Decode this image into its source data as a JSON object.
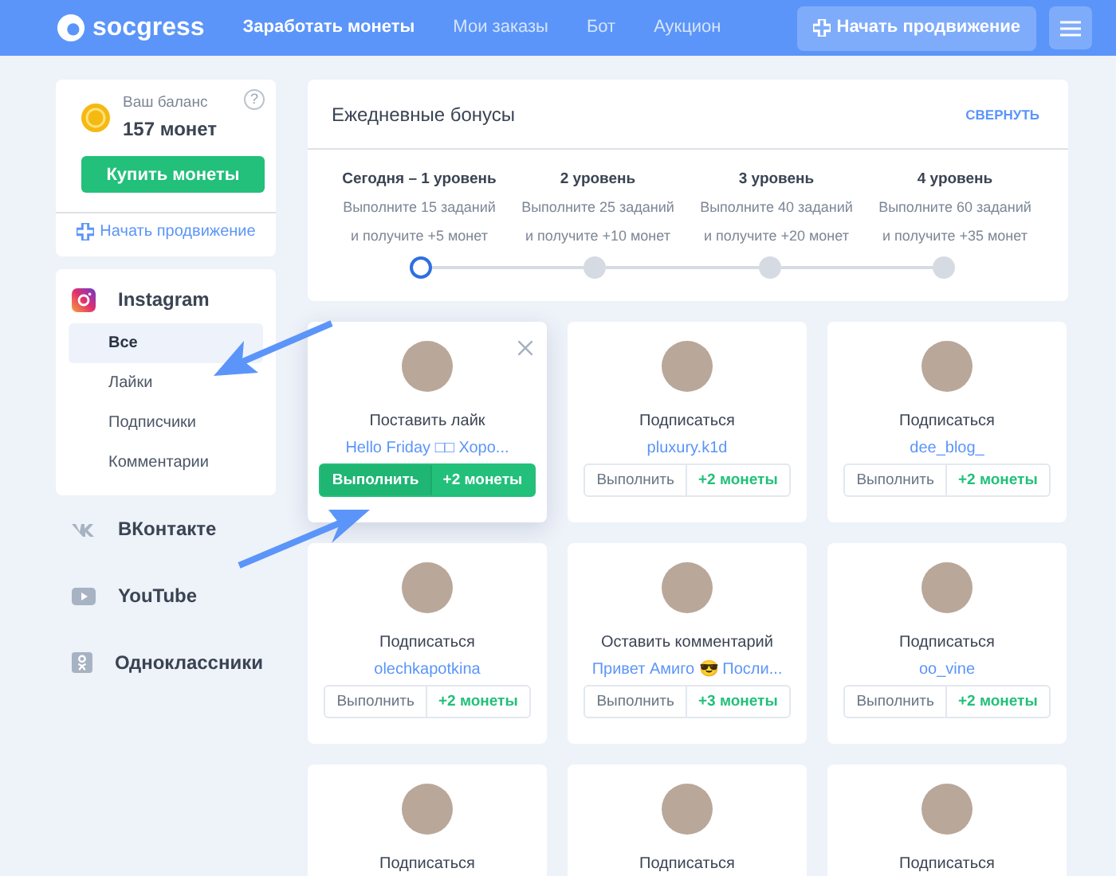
{
  "header": {
    "logo": "socgress",
    "nav": [
      {
        "label": "Заработать монеты",
        "selected": true
      },
      {
        "label": "Мои заказы",
        "selected": false
      },
      {
        "label": "Бот",
        "selected": false
      },
      {
        "label": "Аукцион",
        "selected": false
      }
    ],
    "promote_button": "Начать продвижение"
  },
  "balance": {
    "label": "Ваш баланс",
    "amount": "157 монет",
    "help": "?",
    "buy_button": "Купить монеты",
    "promote_link": "Начать продвижение"
  },
  "networks": [
    {
      "kind": "instagram",
      "label": "Instagram",
      "expanded": true,
      "children": [
        {
          "label": "Все",
          "selected": true
        },
        {
          "label": "Лайки",
          "selected": false
        },
        {
          "label": "Подписчики",
          "selected": false
        },
        {
          "label": "Комментарии",
          "selected": false
        }
      ]
    },
    {
      "kind": "vk",
      "label": "ВКонтакте",
      "expanded": false
    },
    {
      "kind": "youtube",
      "label": "YouTube",
      "expanded": false
    },
    {
      "kind": "ok",
      "label": "Одноклассники",
      "expanded": false
    }
  ],
  "bonuses": {
    "title": "Ежедневные бонусы",
    "collapse": "СВЕРНУТЬ",
    "levels": [
      {
        "title": "Сегодня – 1 уровень",
        "lines": [
          "Выполните 15 заданий",
          "и получите +5 монет"
        ],
        "selected": true
      },
      {
        "title": "2 уровень",
        "lines": [
          "Выполните 25 заданий",
          "и получите +10 монет"
        ],
        "selected": false
      },
      {
        "title": "3 уровень",
        "lines": [
          "Выполните 40 заданий",
          "и получите +20 монет"
        ],
        "selected": false
      },
      {
        "title": "4 уровень",
        "lines": [
          "Выполните 60 заданий",
          "и получите +35 монет"
        ],
        "selected": false
      }
    ]
  },
  "tasks": [
    {
      "action": "Поставить лайк",
      "target": "Hello Friday □□ Хоро...",
      "button": "Выполнить",
      "reward": "+2 монеты",
      "selected": true
    },
    {
      "action": "Подписаться",
      "target": "pluxury.k1d",
      "button": "Выполнить",
      "reward": "+2 монеты",
      "selected": false
    },
    {
      "action": "Подписаться",
      "target": "dee_blog_",
      "button": "Выполнить",
      "reward": "+2 монеты",
      "selected": false
    },
    {
      "action": "Подписаться",
      "target": "olechkapotkina",
      "button": "Выполнить",
      "reward": "+2 монеты",
      "selected": false
    },
    {
      "action": "Оставить комментарий",
      "target": "Привет Амиго 😎 Посли...",
      "button": "Выполнить",
      "reward": "+3 монеты",
      "selected": false
    },
    {
      "action": "Подписаться",
      "target": "oo_vine",
      "button": "Выполнить",
      "reward": "+2 монеты",
      "selected": false
    },
    {
      "action": "Подписаться",
      "selected": false
    },
    {
      "action": "Подписаться",
      "selected": false
    },
    {
      "action": "Подписаться",
      "selected": false
    }
  ]
}
